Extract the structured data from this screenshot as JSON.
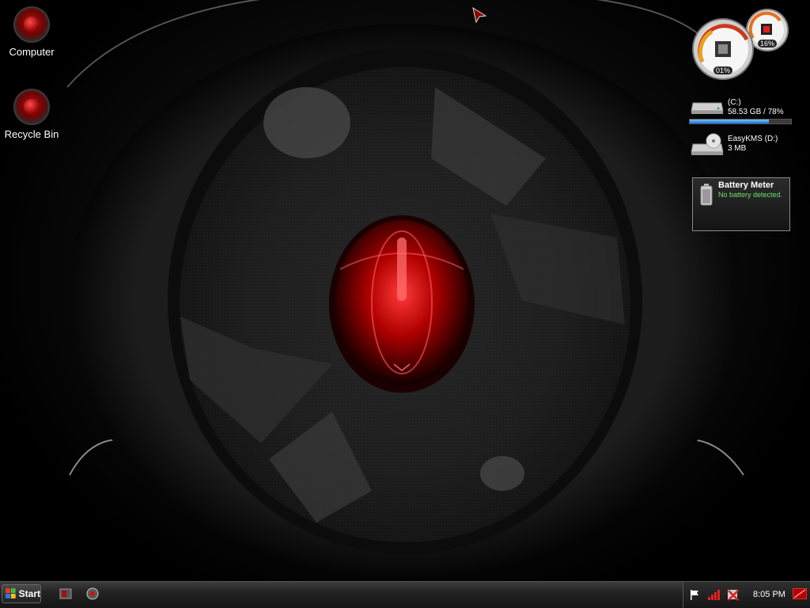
{
  "desktop": {
    "icons": [
      {
        "label": "Computer",
        "icon": "computer-icon"
      },
      {
        "label": "Recycle Bin",
        "icon": "recycle-bin-icon"
      }
    ]
  },
  "gadgets": {
    "cpu_meter": {
      "cpu_percent": "01%",
      "memory_percent": "16%"
    },
    "drives": [
      {
        "name": "(C:)",
        "info": "58.53 GB / 78%",
        "used_fraction": 0.78
      },
      {
        "name": "EasyKMS (D:)",
        "info": "3 MB"
      }
    ],
    "battery_meter": {
      "title": "Battery Meter",
      "status": "No battery detected."
    }
  },
  "taskbar": {
    "start_label": "Start",
    "clock": "8:05 PM"
  },
  "colors": {
    "accent_red": "#c00000",
    "battery_status_green": "#6ee06e",
    "drive_bar_blue": "#1f6fd1"
  }
}
